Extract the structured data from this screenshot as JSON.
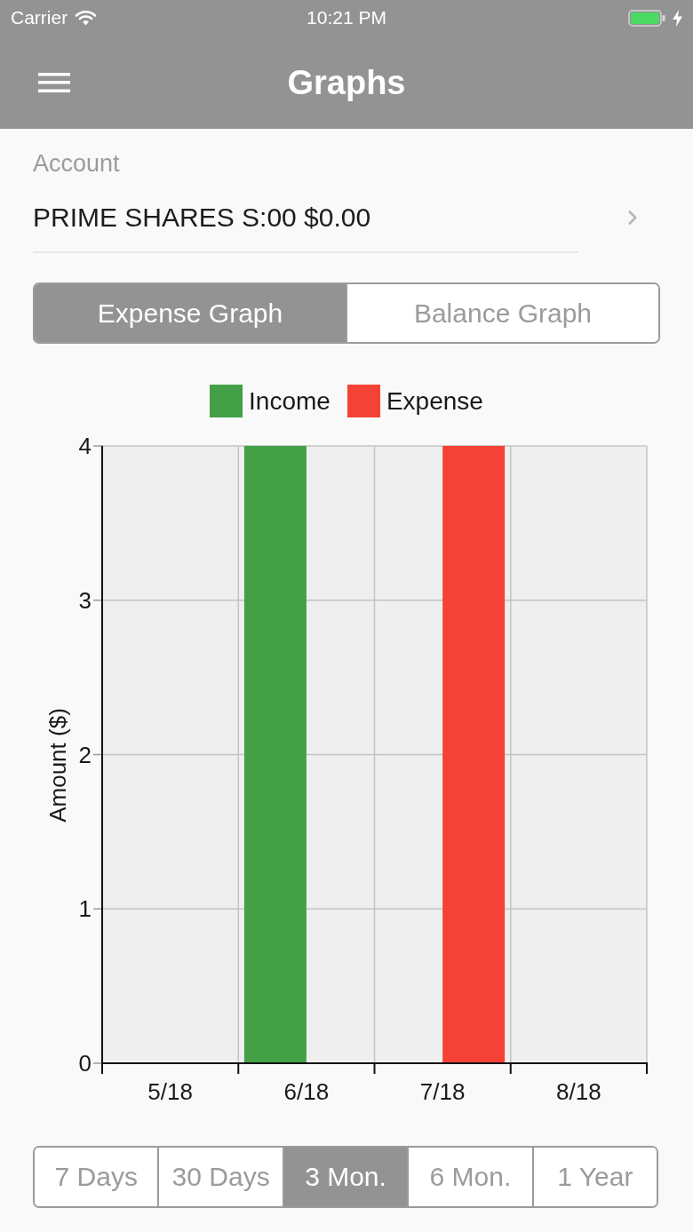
{
  "status_bar": {
    "carrier": "Carrier",
    "time": "10:21 PM"
  },
  "nav_bar": {
    "title": "Graphs"
  },
  "account": {
    "label": "Account",
    "value": "PRIME SHARES S:00 $0.00"
  },
  "graph_tabs": [
    {
      "label": "Expense Graph",
      "selected": true
    },
    {
      "label": "Balance Graph",
      "selected": false
    }
  ],
  "chart": {
    "chart_data": {
      "type": "bar",
      "ylabel": "Amount ($)",
      "categories": [
        "5/18",
        "6/18",
        "7/18",
        "8/18"
      ],
      "series": [
        {
          "name": "Income",
          "color": "#43a047",
          "values": [
            0,
            4,
            0,
            0
          ]
        },
        {
          "name": "Expense",
          "color": "#f44336",
          "values": [
            0,
            0,
            4,
            0
          ]
        }
      ],
      "ylim": [
        0,
        4
      ],
      "yticks": [
        0,
        1,
        2,
        3,
        4
      ],
      "grid": true,
      "legend": "top"
    }
  },
  "ranges": [
    {
      "label": "7 Days",
      "selected": false
    },
    {
      "label": "30 Days",
      "selected": false
    },
    {
      "label": "3 Mon.",
      "selected": true
    },
    {
      "label": "6 Mon.",
      "selected": false
    },
    {
      "label": "1 Year",
      "selected": false
    }
  ]
}
